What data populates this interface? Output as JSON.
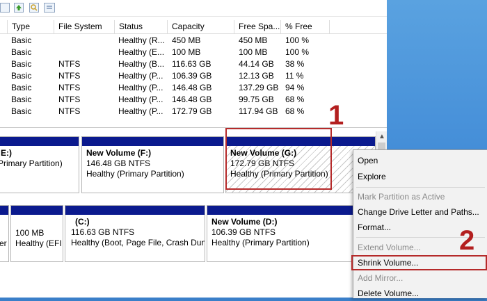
{
  "columns": [
    "Type",
    "File System",
    "Status",
    "Capacity",
    "Free Spa...",
    "% Free"
  ],
  "rows": [
    {
      "type": "Basic",
      "fs": "",
      "status": "Healthy (R...",
      "capacity": "450 MB",
      "free": "450 MB",
      "pct": "100 %"
    },
    {
      "type": "Basic",
      "fs": "",
      "status": "Healthy (E...",
      "capacity": "100 MB",
      "free": "100 MB",
      "pct": "100 %"
    },
    {
      "type": "Basic",
      "fs": "NTFS",
      "status": "Healthy (B...",
      "capacity": "116.63 GB",
      "free": "44.14 GB",
      "pct": "38 %"
    },
    {
      "type": "Basic",
      "fs": "NTFS",
      "status": "Healthy (P...",
      "capacity": "106.39 GB",
      "free": "12.13 GB",
      "pct": "11 %"
    },
    {
      "type": "Basic",
      "fs": "NTFS",
      "status": "Healthy (P...",
      "capacity": "146.48 GB",
      "free": "137.29 GB",
      "pct": "94 %"
    },
    {
      "type": "Basic",
      "fs": "NTFS",
      "status": "Healthy (P...",
      "capacity": "146.48 GB",
      "free": "99.75 GB",
      "pct": "68 %"
    },
    {
      "type": "Basic",
      "fs": "NTFS",
      "status": "Healthy (P...",
      "capacity": "172.79 GB",
      "free": "117.94 GB",
      "pct": "68 %"
    }
  ],
  "disk1": {
    "e": {
      "title": "E:)",
      "line2": "",
      "line3": "Primary Partition)"
    },
    "f": {
      "title": "New Volume  (F:)",
      "line2": "146.48 GB NTFS",
      "line3": "Healthy (Primary Partition)"
    },
    "g": {
      "title": "New Volume  (G:)",
      "line2": "172.79 GB NTFS",
      "line3": "Healthy (Primary Partition)"
    }
  },
  "disk0": {
    "rec": {
      "line3": "er"
    },
    "efi": {
      "line2": "100 MB",
      "line3": "Healthy (EFI"
    },
    "c": {
      "title": "(C:)",
      "line2": "116.63 GB NTFS",
      "line3": "Healthy (Boot, Page File, Crash Dun"
    },
    "d": {
      "title": "New Volume  (D:)",
      "line2": "106.39 GB NTFS",
      "line3": "Healthy (Primary Partition)"
    }
  },
  "menu": {
    "open": "Open",
    "explore": "Explore",
    "mark_active": "Mark Partition as Active",
    "change_letter": "Change Drive Letter and Paths...",
    "format": "Format...",
    "extend": "Extend Volume...",
    "shrink": "Shrink Volume...",
    "mirror": "Add Mirror...",
    "delete": "Delete Volume..."
  },
  "annotations": {
    "step1": "1",
    "step2": "2"
  },
  "colors": {
    "partition_bar": "#0b1a8e",
    "annotation": "#b52a2a"
  }
}
